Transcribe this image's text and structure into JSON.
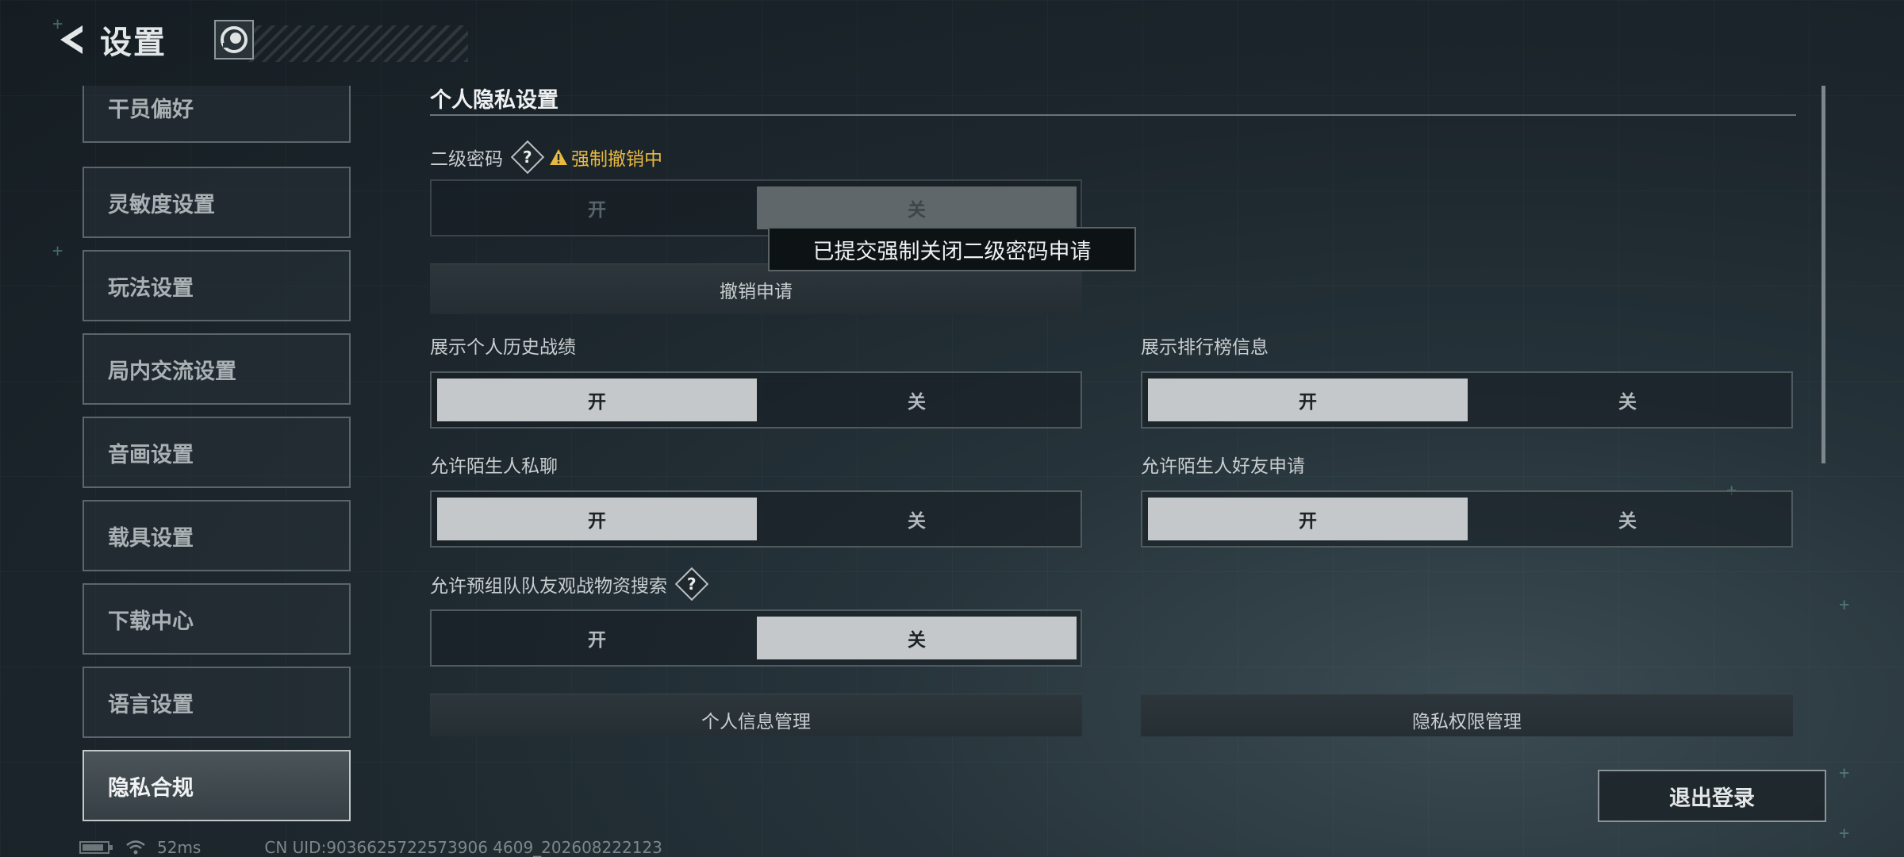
{
  "header": {
    "title": "设置",
    "back_icon": "chevron-left-icon",
    "avatar_icon": "avatar-badge-icon"
  },
  "sidebar": {
    "items": [
      {
        "label": "干员偏好"
      },
      {
        "label": "灵敏度设置"
      },
      {
        "label": "玩法设置"
      },
      {
        "label": "局内交流设置"
      },
      {
        "label": "音画设置"
      },
      {
        "label": "载具设置"
      },
      {
        "label": "下载中心"
      },
      {
        "label": "语言设置"
      },
      {
        "label": "隐私合规",
        "active": true
      }
    ]
  },
  "privacy": {
    "section_title": "个人隐私设置",
    "second_password": {
      "label": "二级密码",
      "help": "?",
      "warning": "强制撤销中",
      "on_label": "开",
      "off_label": "关",
      "selected": "off",
      "enabled": false
    },
    "cancel_request_label": "撤销申请",
    "tooltip": "已提交强制关闭二级密码申请",
    "show_history": {
      "label": "展示个人历史战绩",
      "on_label": "开",
      "off_label": "关",
      "selected": "on"
    },
    "show_leaderboard": {
      "label": "展示排行榜信息",
      "on_label": "开",
      "off_label": "关",
      "selected": "on"
    },
    "stranger_chat": {
      "label": "允许陌生人私聊",
      "on_label": "开",
      "off_label": "关",
      "selected": "on"
    },
    "stranger_friend": {
      "label": "允许陌生人好友申请",
      "on_label": "开",
      "off_label": "关",
      "selected": "on"
    },
    "team_search": {
      "label": "允许预组队队友观战物资搜索",
      "help": "?",
      "on_label": "开",
      "off_label": "关",
      "selected": "off"
    },
    "personal_info_btn": "个人信息管理",
    "privacy_perm_btn": "隐私权限管理"
  },
  "logout_label": "退出登录",
  "status": {
    "ping": "52ms",
    "uid": "CN UID:9036625722573906 4609_202608222123"
  },
  "colors": {
    "warning": "#e8b940",
    "toggle_on": "#c4c8ca",
    "active_sidebar_border": "#c3c9cb"
  }
}
